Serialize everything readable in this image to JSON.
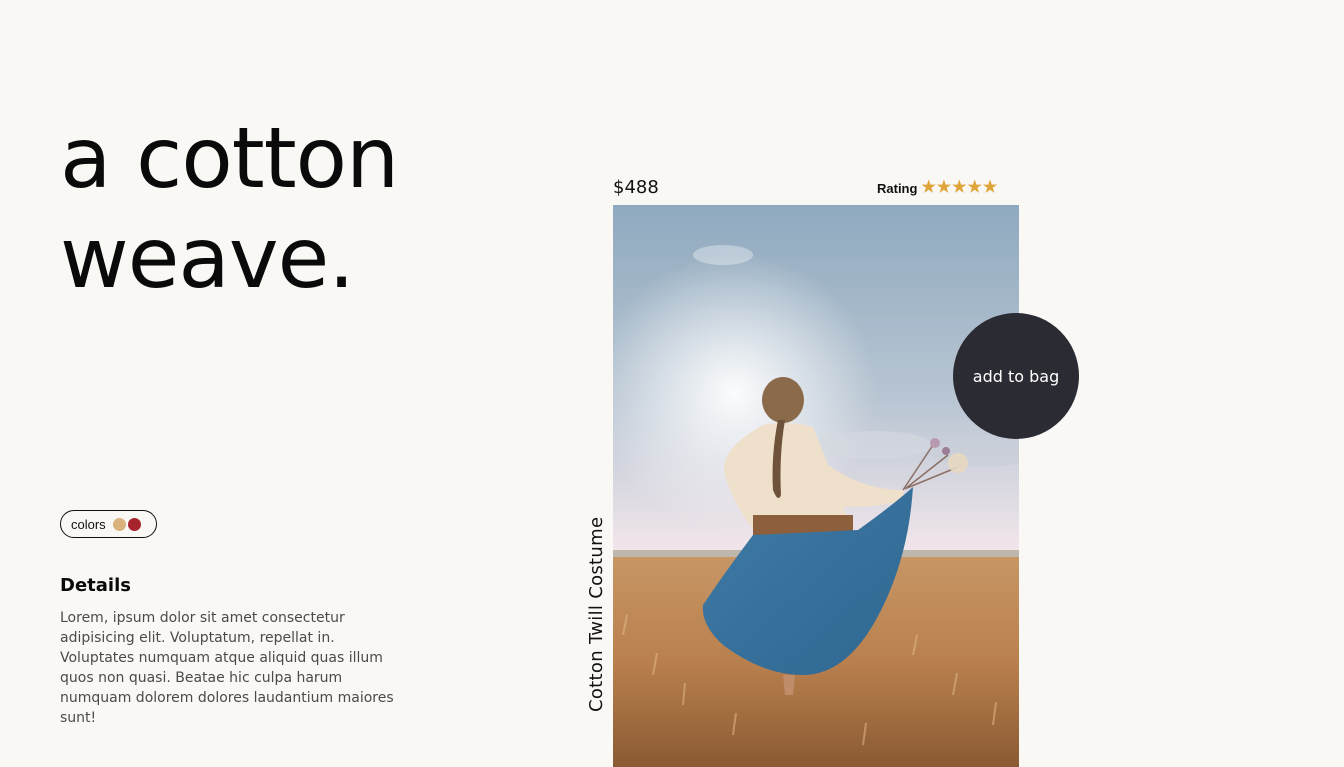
{
  "headline": {
    "line1": "a cotton",
    "line2": "weave."
  },
  "colors": {
    "label": "colors",
    "swatches": [
      {
        "name": "tan",
        "hex": "#d9b27e"
      },
      {
        "name": "red",
        "hex": "#a8242c"
      }
    ]
  },
  "details": {
    "title": "Details",
    "body": "Lorem, ipsum dolor sit amet consectetur adipisicing elit. Voluptatum, repellat in. Voluptates numquam atque aliquid quas illum quos non quasi. Beatae hic culpa harum numquam dolorem dolores laudantium maiores sunt!"
  },
  "product": {
    "price": "$488",
    "name": "Cotton Twill Costume",
    "rating_label": "Rating",
    "rating_value": 5,
    "rating_max": 5,
    "star_color": "#e0a53a",
    "add_to_bag_label": "add to bag",
    "add_to_bag_color": "#2b2b33"
  }
}
